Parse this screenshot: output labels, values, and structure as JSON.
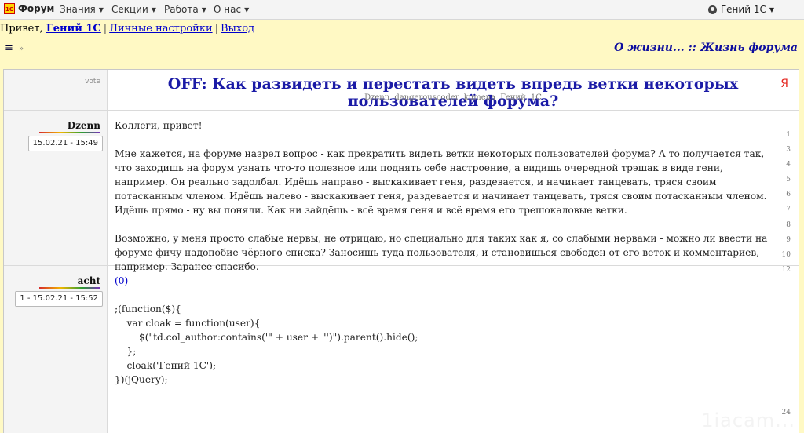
{
  "navbar": {
    "logo_text": "1С",
    "brand": "Форум",
    "menu": [
      {
        "label": "Знания"
      },
      {
        "label": "Секции"
      },
      {
        "label": "Работа"
      },
      {
        "label": "О нас"
      }
    ],
    "user": "Гений 1С"
  },
  "greeting": {
    "prefix": "Привет,",
    "username": "Гений 1С",
    "settings_link": "Личные настройки",
    "logout_link": "Выход"
  },
  "toolbar": {
    "hamburger": "≡",
    "more": "»"
  },
  "breadcrumb": "О жизни... :: Жизнь форума",
  "thread": {
    "vote_label": "vote",
    "title": "OFF: Как развидеть и перестать видеть впредь ветки некоторых пользователей форума?",
    "authors": "Dzenn  dangerouscoder  kumena  Гений 1С",
    "ya_icon": "Я",
    "posts": [
      {
        "author": "Dzenn",
        "date": "15.02.21 - 15:49",
        "paragraphs": [
          "Коллеги, привет!",
          "Мне кажется, на форуме назрел вопрос - как прекратить видеть ветки некоторых пользователей форума? А то получается так, что заходишь на форум узнать что-то полезное или поднять себе настроение, а видишь очередной трэшак в виде гени, например. Он реально задолбал. Идёшь направо - выскакивает геня, раздевается, и начинает танцевать, тряся своим потасканным членом. Идёшь налево - выскакивает геня, раздевается и начинает танцевать, тряся своим потасканным членом. Идёшь прямо - ну вы поняли. Как ни зайдёшь - всё время геня и всё время его трешокаловые ветки.",
          "Возможно, у меня просто слабые нервы, не отрицаю, но специально для таких как я, со слабыми нервами - можно ли ввести на форуме фичу надопобие чёрного списка? Заносишь туда пользователя, и становишься свободен от его веток и комментариев, например. Заранее спасибо."
        ],
        "line_numbers": [
          "1",
          "3",
          "4",
          "5",
          "6",
          "7",
          "8",
          "9",
          "10",
          "12"
        ]
      },
      {
        "author": "acht",
        "date": "1 - 15.02.21 - 15:52",
        "reply_ref": "(0)",
        "code": [
          ";(function($){",
          "",
          "    var cloak = function(user){",
          "        $(\"td.col_author:contains('\" + user + \"')\").parent().hide();",
          "    };",
          "",
          "    cloak('Гений 1С');",
          "",
          "})(jQuery);"
        ],
        "line_numbers": [
          "24"
        ]
      }
    ]
  },
  "watermark": "1iacam..."
}
